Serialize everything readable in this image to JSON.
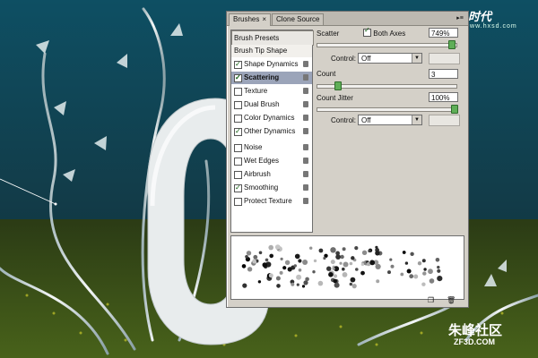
{
  "tabs": [
    {
      "label": "Brushes",
      "close": "×"
    },
    {
      "label": "Clone Source"
    }
  ],
  "brush_presets_label": "Brush Presets",
  "brush_tip_shape_label": "Brush Tip Shape",
  "brush_options": [
    {
      "label": "Shape Dynamics",
      "checked": true,
      "selected": false
    },
    {
      "label": "Scattering",
      "checked": true,
      "selected": true
    },
    {
      "label": "Texture",
      "checked": false,
      "selected": false
    },
    {
      "label": "Dual Brush",
      "checked": false,
      "selected": false
    },
    {
      "label": "Color Dynamics",
      "checked": false,
      "selected": false
    },
    {
      "label": "Other Dynamics",
      "checked": true,
      "selected": false
    },
    {
      "label": "Noise",
      "checked": false,
      "selected": false
    },
    {
      "label": "Wet Edges",
      "checked": false,
      "selected": false
    },
    {
      "label": "Airbrush",
      "checked": false,
      "selected": false
    },
    {
      "label": "Smoothing",
      "checked": true,
      "selected": false
    },
    {
      "label": "Protect Texture",
      "checked": false,
      "selected": false
    }
  ],
  "scatter": {
    "label": "Scatter",
    "both_axes_label": "Both Axes",
    "both_axes_checked": true,
    "value": "749%",
    "slider_fraction": 0.98,
    "control_label": "Control:",
    "control_value": "Off"
  },
  "count": {
    "label": "Count",
    "value": "3",
    "slider_fraction": 0.13
  },
  "count_jitter": {
    "label": "Count Jitter",
    "value": "100%",
    "slider_fraction": 1.0,
    "control_label": "Control:",
    "control_value": "Off"
  },
  "watermarks": {
    "top_logo": "火星时代",
    "top_site": "www.hxsd.com",
    "bottom_logo": "朱峰社区",
    "bottom_site": "ZF3D.COM"
  },
  "colors": {
    "panel": "#d4d0c8",
    "selection": "#9ba4b9",
    "slider_knob": "#5fae57"
  }
}
